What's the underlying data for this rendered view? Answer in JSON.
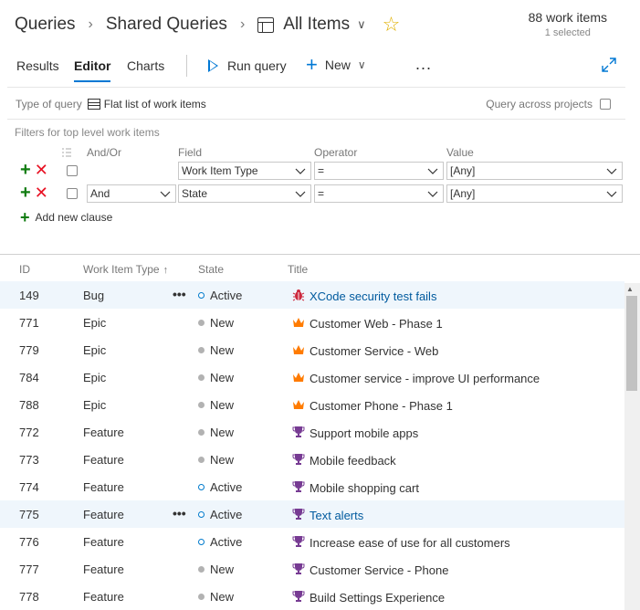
{
  "breadcrumb": {
    "queries": "Queries",
    "shared": "Shared Queries",
    "current": "All Items"
  },
  "counts": {
    "work_items": "88 work items",
    "selected": "1 selected"
  },
  "tabs": {
    "results": "Results",
    "editor": "Editor",
    "charts": "Charts"
  },
  "toolbar": {
    "run_query": "Run query",
    "new": "New",
    "more": "..."
  },
  "options": {
    "type_label": "Type of query",
    "type_value": "Flat list of work items",
    "across_projects": "Query across projects"
  },
  "filters": {
    "label": "Filters for top level work items",
    "headers": {
      "and_or": "And/Or",
      "field": "Field",
      "operator": "Operator",
      "value": "Value"
    },
    "clauses": [
      {
        "and_or": "",
        "field": "Work Item Type",
        "operator": "=",
        "value": "[Any]"
      },
      {
        "and_or": "And",
        "field": "State",
        "operator": "=",
        "value": "[Any]"
      }
    ],
    "add_clause": "Add new clause"
  },
  "results": {
    "headers": {
      "id": "ID",
      "type": "Work Item Type",
      "state": "State",
      "title": "Title"
    },
    "rows": [
      {
        "id": "149",
        "type": "Bug",
        "state": "Active",
        "title": "XCode security test fails",
        "icon": "bug-icon"
      },
      {
        "id": "771",
        "type": "Epic",
        "state": "New",
        "title": "Customer Web - Phase 1",
        "icon": "crown-icon"
      },
      {
        "id": "779",
        "type": "Epic",
        "state": "New",
        "title": "Customer Service - Web",
        "icon": "crown-icon"
      },
      {
        "id": "784",
        "type": "Epic",
        "state": "New",
        "title": "Customer service - improve UI performance",
        "icon": "crown-icon"
      },
      {
        "id": "788",
        "type": "Epic",
        "state": "New",
        "title": "Customer Phone - Phase 1",
        "icon": "crown-icon"
      },
      {
        "id": "772",
        "type": "Feature",
        "state": "New",
        "title": "Support mobile apps",
        "icon": "trophy-icon"
      },
      {
        "id": "773",
        "type": "Feature",
        "state": "New",
        "title": "Mobile feedback",
        "icon": "trophy-icon"
      },
      {
        "id": "774",
        "type": "Feature",
        "state": "Active",
        "title": "Mobile shopping cart",
        "icon": "trophy-icon"
      },
      {
        "id": "775",
        "type": "Feature",
        "state": "Active",
        "title": "Text alerts",
        "icon": "trophy-icon"
      },
      {
        "id": "776",
        "type": "Feature",
        "state": "Active",
        "title": "Increase ease of use for all customers",
        "icon": "trophy-icon"
      },
      {
        "id": "777",
        "type": "Feature",
        "state": "New",
        "title": "Customer Service - Phone",
        "icon": "trophy-icon"
      },
      {
        "id": "778",
        "type": "Feature",
        "state": "New",
        "title": "Build Settings Experience",
        "icon": "trophy-icon"
      }
    ]
  },
  "colors": {
    "accent": "#0078d4",
    "bug": "#cc293d",
    "epic": "#ff7b00",
    "feature": "#773b93",
    "add": "#107c10",
    "delete": "#e81123",
    "star": "#e0b000"
  }
}
